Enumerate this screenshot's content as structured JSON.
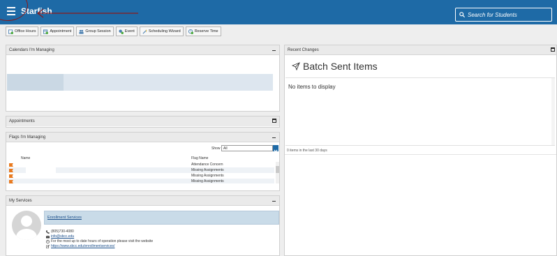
{
  "header": {
    "brand": "Starfish",
    "search_placeholder": "Search for Students"
  },
  "toolbar": {
    "buttons": [
      {
        "label": "Office Hours",
        "icon": "office-hours-icon"
      },
      {
        "label": "Appointment",
        "icon": "calendar-add-icon"
      },
      {
        "label": "Group Session",
        "icon": "group-icon"
      },
      {
        "label": "Event",
        "icon": "event-icon"
      },
      {
        "label": "Scheduling Wizard",
        "icon": "wand-icon"
      },
      {
        "label": "Reserve Time",
        "icon": "reserve-time-icon"
      }
    ]
  },
  "calendars": {
    "title": "Calendars I'm Managing"
  },
  "appointments": {
    "title": "Appointments"
  },
  "flags": {
    "title": "Flags I'm Managing",
    "show_label": "Show",
    "show_value": "All",
    "col_name": "Name",
    "col_flag": "Flag Name",
    "rows": [
      {
        "flag": "Attendance Concern"
      },
      {
        "flag": "Missing Assignments"
      },
      {
        "flag": "Missing Assignments"
      },
      {
        "flag": "Missing Assignments"
      }
    ]
  },
  "services": {
    "title": "My Services",
    "service_name": "Enrollment Services",
    "phone": "(805)730-4080",
    "email": "info@sbcc.edu",
    "hours": "For the most up to date hours of operation please visit the website",
    "website": "https://www.sbcc.edu/enrollmentservices/"
  },
  "recent": {
    "title": "Recent Changes",
    "batch_title": "Batch Sent Items",
    "empty_text": "No items to display",
    "footer": "0 items in the last 30 days"
  },
  "colors": {
    "topbar": "#1e6aa6",
    "flag": "#e8791e",
    "annotation": "#8b1a1a"
  }
}
